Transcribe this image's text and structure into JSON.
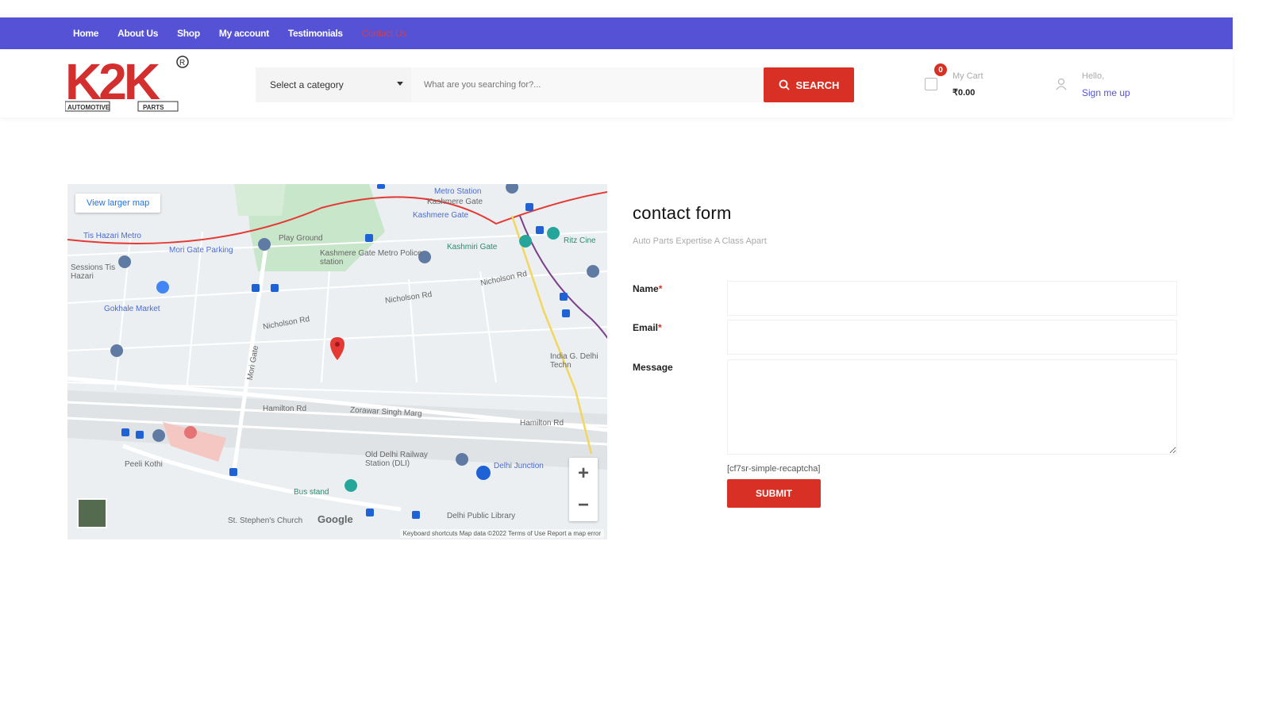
{
  "nav": {
    "items": [
      {
        "label": "Home"
      },
      {
        "label": "About Us"
      },
      {
        "label": "Shop"
      },
      {
        "label": "My account"
      },
      {
        "label": "Testimonials"
      },
      {
        "label": "Contact Us"
      }
    ]
  },
  "header": {
    "logo_text": "K2K",
    "logo_sub_left": "AUTOMOTIVE",
    "logo_sub_right": "PARTS",
    "category_placeholder": "Select a category",
    "search_placeholder": "What are you searching for?...",
    "search_label": "SEARCH",
    "cart": {
      "count": "0",
      "label": "My Cart",
      "price": "₹0.00"
    },
    "account": {
      "greeting": "Hello,",
      "signin": "Sign me up"
    }
  },
  "map": {
    "larger_link": "View larger map",
    "google": "Google",
    "footer": "Keyboard shortcuts   Map data ©2022   Terms of Use   Report a map error",
    "labels": {
      "metro_station": "Metro Station",
      "kashmere_gate": "Kashmere Gate",
      "tis_hazari_metro": "Tis Hazari Metro",
      "mori_gate": "Mori Gate Parking",
      "play_ground": "Play Ground",
      "kashmere_metro_police": "Kashmere Gate Metro Police station",
      "sessions": "Sessions Tis Hazari",
      "kashmiri_gate": "Kashmiri Gate",
      "ritz": "Ritz Cine",
      "gokhale": "Gokhale Market",
      "nicholson": "Nicholson Rd",
      "mori_gate_rd": "Mori Gate",
      "hamilton": "Hamilton Rd",
      "zorawar": "Zorawar Singh Marg",
      "old_delhi_rly": "Old Delhi Railway Station (DLI)",
      "delhi_jn": "Delhi Junction",
      "bus_stand": "Bus stand",
      "delhi_library": "Delhi Public Library",
      "stephens": "St. Stephen's Church",
      "peeli_kothi": "Peeli Kothi",
      "india_gate": "India G. Delhi Techn"
    }
  },
  "contact": {
    "title": "contact form",
    "subtitle": "Auto Parts Expertise A Class Apart",
    "name_label": "Name",
    "email_label": "Email",
    "message_label": "Message",
    "required_mark": "*",
    "captcha": "[cf7sr-simple-recaptcha]",
    "submit": "SUBMIT"
  },
  "colors": {
    "nav_bg": "#5552d6",
    "accent_red": "#d93025",
    "link_blue": "#5552d6"
  }
}
